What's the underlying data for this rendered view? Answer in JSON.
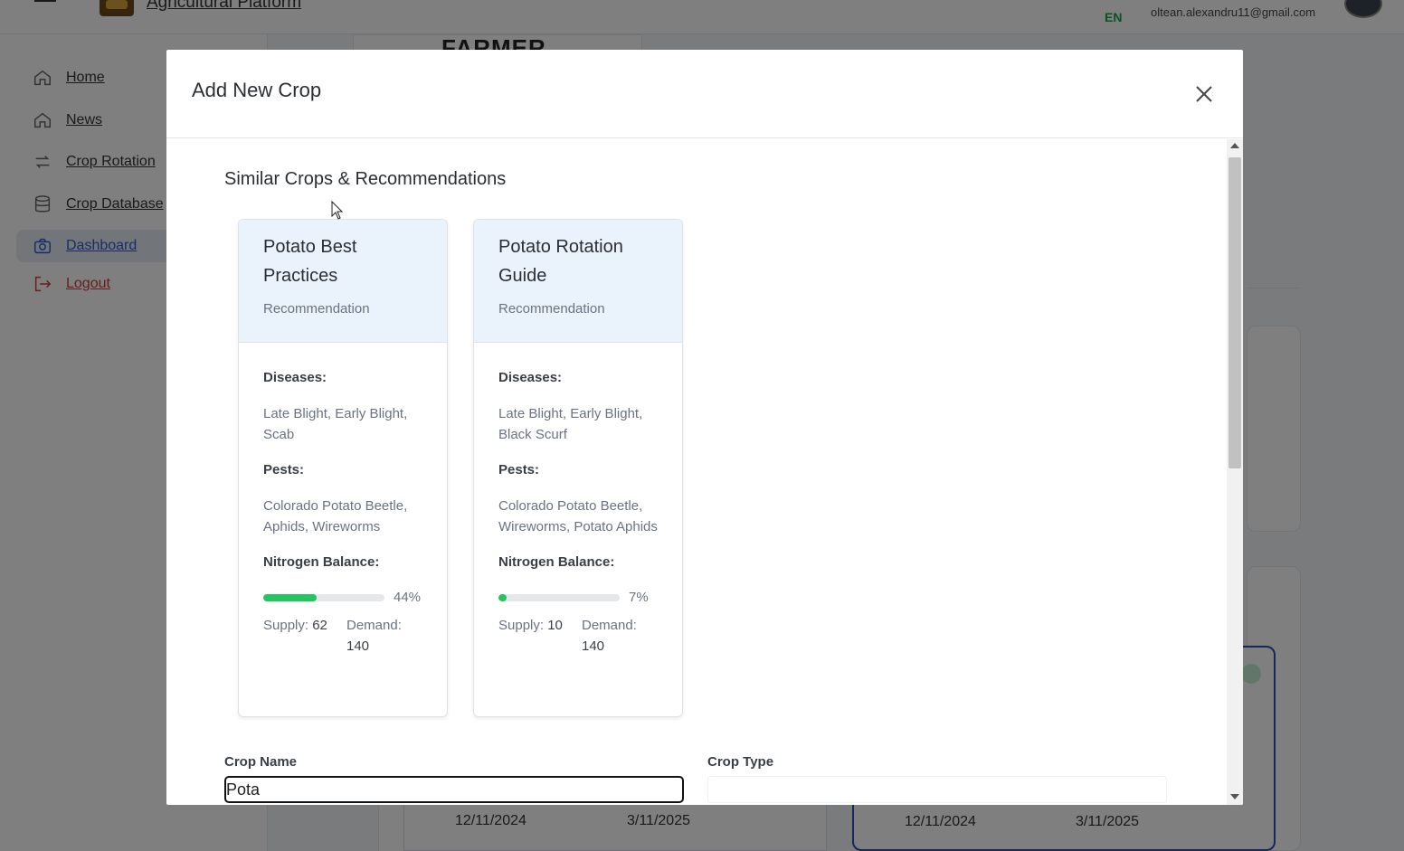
{
  "app": {
    "title": "Agricultural Platform",
    "language": "EN",
    "user_email": "oltean.alexandru11@gmail.com",
    "background_heading": "FARMER"
  },
  "sidebar": {
    "items": [
      {
        "label": "Home",
        "icon": "home-icon"
      },
      {
        "label": "News",
        "icon": "home-icon"
      },
      {
        "label": "Crop Rotation",
        "icon": "rotate-arrows-icon"
      },
      {
        "label": "Crop Database",
        "icon": "database-icon"
      },
      {
        "label": "Dashboard",
        "icon": "camera-icon",
        "active": true
      },
      {
        "label": "Logout",
        "icon": "logout-icon"
      }
    ]
  },
  "background_cards": {
    "card1": {
      "start": "12/11/2024",
      "end": "3/11/2025"
    },
    "card2": {
      "start": "12/11/2024",
      "end": "3/11/2025"
    }
  },
  "modal": {
    "title": "Add New Crop",
    "section_title": "Similar Crops & Recommendations",
    "labels": {
      "diseases": "Diseases:",
      "pests": "Pests:",
      "nitrogen": "Nitrogen Balance:",
      "supply": "Supply:",
      "demand": "Demand:"
    },
    "cards": [
      {
        "title": "Potato Best Practices",
        "type": "Recommendation",
        "diseases": "Late Blight, Early Blight, Scab",
        "pests": "Colorado Potato Beetle, Aphids, Wireworms",
        "nitrogen_percent": 44,
        "nitrogen_percent_label": "44%",
        "supply": "62",
        "demand": "140"
      },
      {
        "title": "Potato Rotation Guide",
        "type": "Recommendation",
        "diseases": "Late Blight, Early Blight, Black Scurf",
        "pests": "Colorado Potato Beetle, Wireworms, Potato Aphids",
        "nitrogen_percent": 7,
        "nitrogen_percent_label": "7%",
        "supply": "10",
        "demand": "140"
      }
    ],
    "form": {
      "crop_name_label": "Crop Name",
      "crop_name_value": "Pota",
      "crop_type_label": "Crop Type",
      "crop_type_value": ""
    }
  },
  "colors": {
    "accent_green": "#22c55e",
    "card_header_bg": "#eaf2fc",
    "active_nav": "#2c5bd0",
    "logout_red": "#d23a3a",
    "language_green": "#1aa14a"
  }
}
